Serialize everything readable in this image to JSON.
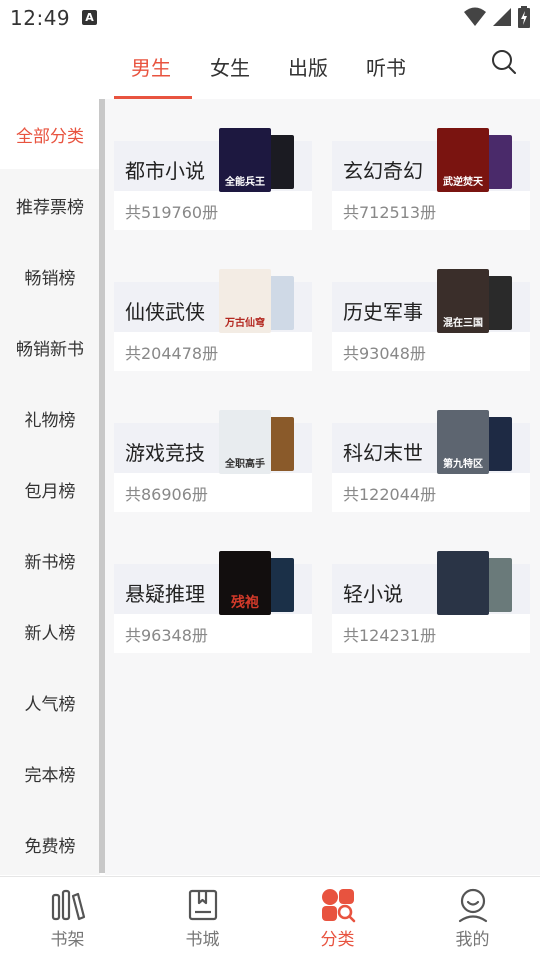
{
  "status": {
    "time": "12:49"
  },
  "tabs": [
    "男生",
    "女生",
    "出版",
    "听书"
  ],
  "active_tab": "男生",
  "sidebar": {
    "items": [
      "全部分类",
      "推荐票榜",
      "畅销榜",
      "畅销新书",
      "礼物榜",
      "包月榜",
      "新书榜",
      "新人榜",
      "人气榜",
      "完本榜",
      "免费榜"
    ],
    "active": "全部分类"
  },
  "categories": [
    {
      "name": "都市小说",
      "count": "共519760册",
      "cover_text": "全能兵王",
      "back_color": "#1b1b22",
      "front_color": "#1d1840"
    },
    {
      "name": "玄幻奇幻",
      "count": "共712513册",
      "cover_text": "武逆焚天",
      "back_color": "#4a2a6a",
      "front_color": "#7a1410"
    },
    {
      "name": "仙侠武侠",
      "count": "共204478册",
      "cover_text": "万古仙穹",
      "back_color": "#cfd9e6",
      "front_color": "#f3ece4"
    },
    {
      "name": "历史军事",
      "count": "共93048册",
      "cover_text": "混在三国",
      "back_color": "#2a2a2a",
      "front_color": "#3a2e2a"
    },
    {
      "name": "游戏竞技",
      "count": "共86906册",
      "cover_text": "全职高手",
      "back_color": "#8a5a2a",
      "front_color": "#e8ecef"
    },
    {
      "name": "科幻末世",
      "count": "共122044册",
      "cover_text": "第九特区",
      "back_color": "#1e2a44",
      "front_color": "#5d6570"
    },
    {
      "name": "悬疑推理",
      "count": "共96348册",
      "cover_text": "残袍",
      "back_color": "#1b3048",
      "front_color": "#120e0e"
    },
    {
      "name": "轻小说",
      "count": "共124231册",
      "cover_text": "",
      "back_color": "#6a7a7a",
      "front_color": "#2a3446"
    }
  ],
  "bottom_nav": [
    {
      "label": "书架",
      "icon": "bookshelf-icon"
    },
    {
      "label": "书城",
      "icon": "bookstore-icon"
    },
    {
      "label": "分类",
      "icon": "category-icon"
    },
    {
      "label": "我的",
      "icon": "profile-icon"
    }
  ],
  "active_nav": "分类",
  "colors": {
    "accent": "#e8533f",
    "text": "#333333",
    "muted": "#888888",
    "sidebar_bg": "#f6f6f6",
    "card_top_bg": "#f0f1f6"
  }
}
